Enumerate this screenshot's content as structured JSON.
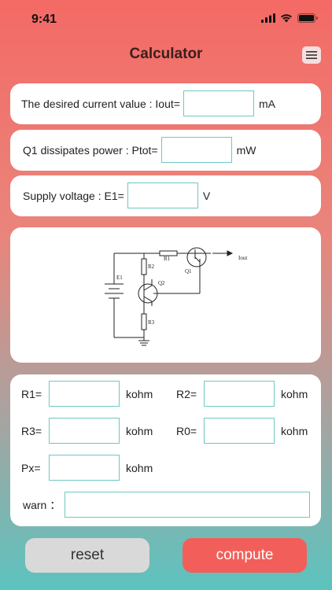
{
  "status": {
    "time": "9:41"
  },
  "header": {
    "title": "Calculator"
  },
  "inputs": {
    "iout": {
      "label": "The desired current value :  Iout=",
      "unit": "mA",
      "value": ""
    },
    "ptot": {
      "label": "Q1 dissipates power :  Ptot=",
      "unit": "mW",
      "value": ""
    },
    "e1": {
      "label": "Supply voltage :  E1=",
      "unit": "V",
      "value": ""
    }
  },
  "circuit": {
    "labels": {
      "r1": "R1",
      "r2": "R2",
      "r3": "R3",
      "e1": "E1",
      "q1": "Q1",
      "q2": "Q2",
      "iout": "Iout"
    }
  },
  "results": {
    "r1": {
      "label": "R1=",
      "unit": "kohm",
      "value": ""
    },
    "r2": {
      "label": "R2=",
      "unit": "kohm",
      "value": ""
    },
    "r3": {
      "label": "R3=",
      "unit": "kohm",
      "value": ""
    },
    "r0": {
      "label": "R0=",
      "unit": "kohm",
      "value": ""
    },
    "px": {
      "label": "Px=",
      "unit": "kohm",
      "value": ""
    },
    "warn": {
      "label": "warn  ：",
      "value": ""
    }
  },
  "buttons": {
    "reset": "reset",
    "compute": "compute"
  },
  "colors": {
    "accent": "#f46a65",
    "field_border": "#6fc7c2",
    "reset_bg": "#d9d9d9",
    "compute_bg": "#f25f5a"
  }
}
